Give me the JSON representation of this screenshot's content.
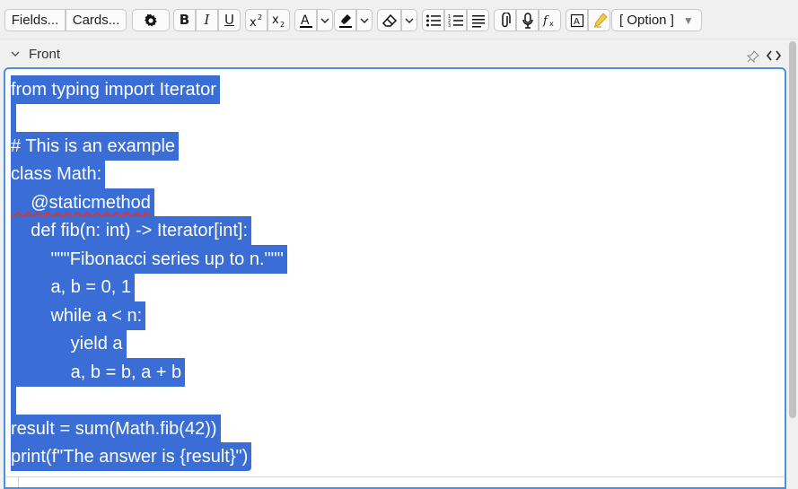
{
  "toolbar": {
    "fields_label": "Fields...",
    "cards_label": "Cards...",
    "option_label": "[ Option ]",
    "option_arrow": "▼",
    "bold_label": "B",
    "italic_label": "I",
    "underline_label": "U",
    "text_color_hex": "#000000",
    "highlight_color_hex": "#000000"
  },
  "field": {
    "name": "Front"
  },
  "code_lines": [
    "from typing import Iterator",
    "",
    "# This is an example",
    "class Math:",
    "    @staticmethod",
    "    def fib(n: int) -> Iterator[int]:",
    "        \"\"\"Fibonacci series up to n.\"\"\"",
    "        a, b = 0, 1",
    "        while a < n:",
    "            yield a",
    "            a, b = b, a + b",
    "",
    "result = sum(Math.fib(42))",
    "print(f\"The answer is {result}\")"
  ],
  "colors": {
    "selection": "#3a6ed6",
    "focus_border": "#4a90e2",
    "spell_error": "#e03030"
  }
}
